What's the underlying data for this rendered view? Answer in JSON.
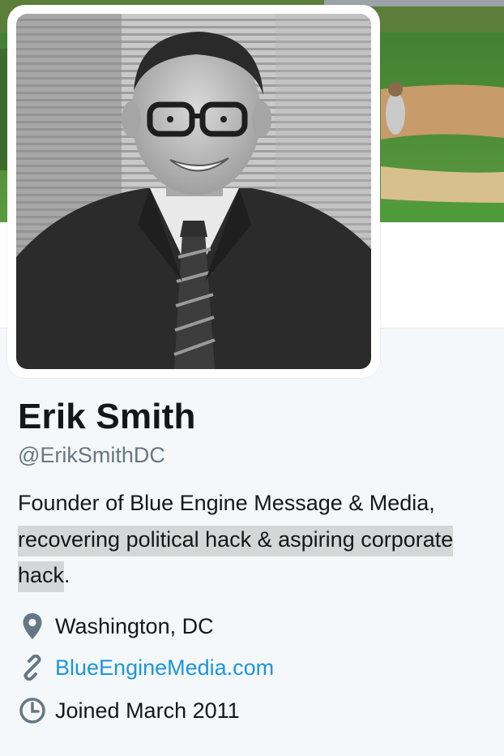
{
  "profile": {
    "name": "Erik Smith",
    "handle": "@ErikSmithDC",
    "bio": {
      "part1": "Founder of Blue Engine Message & Media, ",
      "highlighted": "recovering political hack & aspiring corporate hack",
      "part2": "."
    },
    "location": "Washington, DC",
    "website": "BlueEngineMedia.com",
    "joined": "Joined March 2011"
  },
  "icons": {
    "location": "map-pin-icon",
    "website": "link-icon",
    "joined": "clock-icon"
  },
  "colors": {
    "name": "#14171a",
    "muted": "#657786",
    "link": "#1b95e0",
    "card_bg": "#f5f8fa",
    "highlight": "#d5d6d6"
  }
}
